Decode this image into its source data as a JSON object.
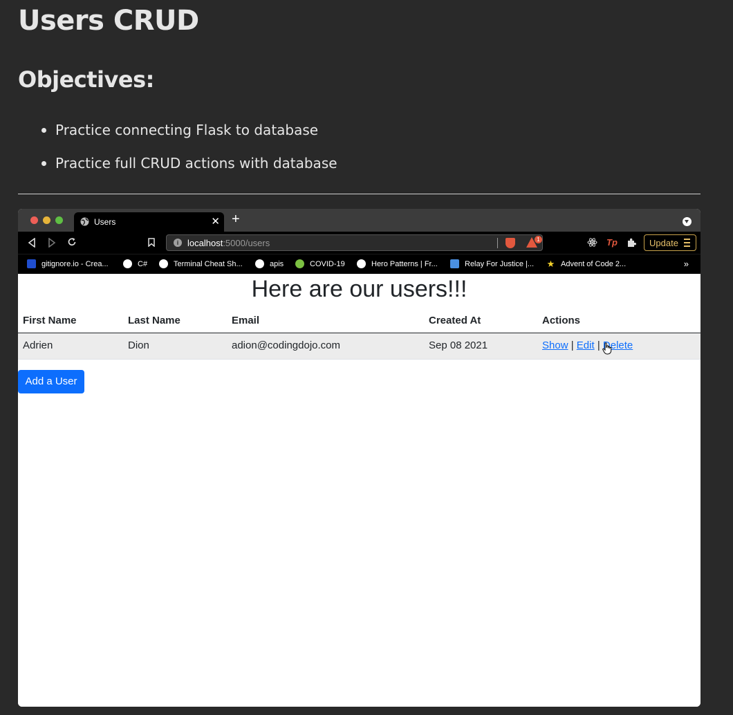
{
  "doc": {
    "title": "Users CRUD",
    "objectives_heading": "Objectives:",
    "objectives": [
      "Practice connecting Flask to database",
      "Practice full CRUD actions with database"
    ]
  },
  "browser": {
    "tab_title": "Users",
    "tab_close": "✕",
    "new_tab": "+",
    "url_host": "localhost",
    "url_path": ":5000/users",
    "alert_badge": "1",
    "update_label": "Update",
    "bookmarks": [
      {
        "label": "gitignore.io - Crea...",
        "color": "#204ecf"
      },
      {
        "label": "C#",
        "color": "#ffffff"
      },
      {
        "label": "Terminal Cheat Sh...",
        "color": "#ffffff"
      },
      {
        "label": "apis",
        "color": "#ffffff"
      },
      {
        "label": "COVID-19",
        "color": "#7cc142"
      },
      {
        "label": "Hero Patterns | Fr...",
        "color": "#ffffff"
      },
      {
        "label": "Relay For Justice |...",
        "color": "#4a90e2"
      },
      {
        "label": "Advent of Code 2...",
        "color": "#f5d22b"
      }
    ],
    "bookmarks_more": "»"
  },
  "page": {
    "heading": "Here are our users!!!",
    "columns": [
      "First Name",
      "Last Name",
      "Email",
      "Created At",
      "Actions"
    ],
    "rows": [
      {
        "first_name": "Adrien",
        "last_name": "Dion",
        "email": "adion@codingdojo.com",
        "created_at": "Sep 08 2021",
        "actions": [
          "Show",
          "Edit",
          "Delete"
        ],
        "separator": "|"
      }
    ],
    "add_button": "Add a User"
  },
  "colors": {
    "background": "#292929",
    "link": "#0d6efd",
    "button": "#0d6efd",
    "update_accent": "#e6c06a",
    "brave": "#e2583e"
  }
}
